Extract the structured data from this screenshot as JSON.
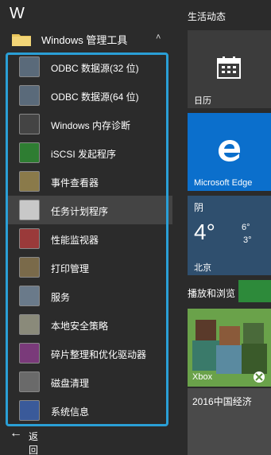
{
  "header": {
    "letter": "W"
  },
  "folder": {
    "label": "Windows 管理工具",
    "chevron": "˄"
  },
  "items": [
    {
      "label": "ODBC 数据源(32 位)",
      "icon": "odbc-32-icon",
      "color": "#5a6a7a"
    },
    {
      "label": "ODBC 数据源(64 位)",
      "icon": "odbc-64-icon",
      "color": "#5a6a7a"
    },
    {
      "label": "Windows 内存诊断",
      "icon": "memory-diagnostic-icon",
      "color": "#444"
    },
    {
      "label": "iSCSI 发起程序",
      "icon": "iscsi-globe-icon",
      "color": "#2e7d32"
    },
    {
      "label": "事件查看器",
      "icon": "event-viewer-icon",
      "color": "#8a7a4a"
    },
    {
      "label": "任务计划程序",
      "icon": "task-scheduler-clock-icon",
      "color": "#c8c8c8"
    },
    {
      "label": "性能监视器",
      "icon": "performance-monitor-icon",
      "color": "#9a3a3a"
    },
    {
      "label": "打印管理",
      "icon": "print-management-icon",
      "color": "#7a6a4a"
    },
    {
      "label": "服务",
      "icon": "services-gear-icon",
      "color": "#6a7a8a"
    },
    {
      "label": "本地安全策略",
      "icon": "local-security-policy-icon",
      "color": "#8a8a7a"
    },
    {
      "label": "碎片整理和优化驱动器",
      "icon": "defrag-icon",
      "color": "#7a3a7a"
    },
    {
      "label": "磁盘清理",
      "icon": "disk-cleanup-icon",
      "color": "#6a6a6a"
    },
    {
      "label": "系统信息",
      "icon": "system-info-icon",
      "color": "#3a5a9a"
    }
  ],
  "back": {
    "label": "返回"
  },
  "sections": {
    "life": "生活动态",
    "play": "播放和浏览"
  },
  "tiles": {
    "calendar": {
      "label": "日历"
    },
    "edge": {
      "label": "Microsoft Edge"
    },
    "weather": {
      "condition": "阴",
      "temp": "4°",
      "high": "6°",
      "low": "3°",
      "city": "北京"
    },
    "xbox": {
      "label": "Xbox"
    },
    "news": {
      "label": "2016中国经济"
    }
  },
  "colors": {
    "accent": "#2a9fd6",
    "edge_tile": "#0b6fcc",
    "panel": "#2b2b2b"
  }
}
